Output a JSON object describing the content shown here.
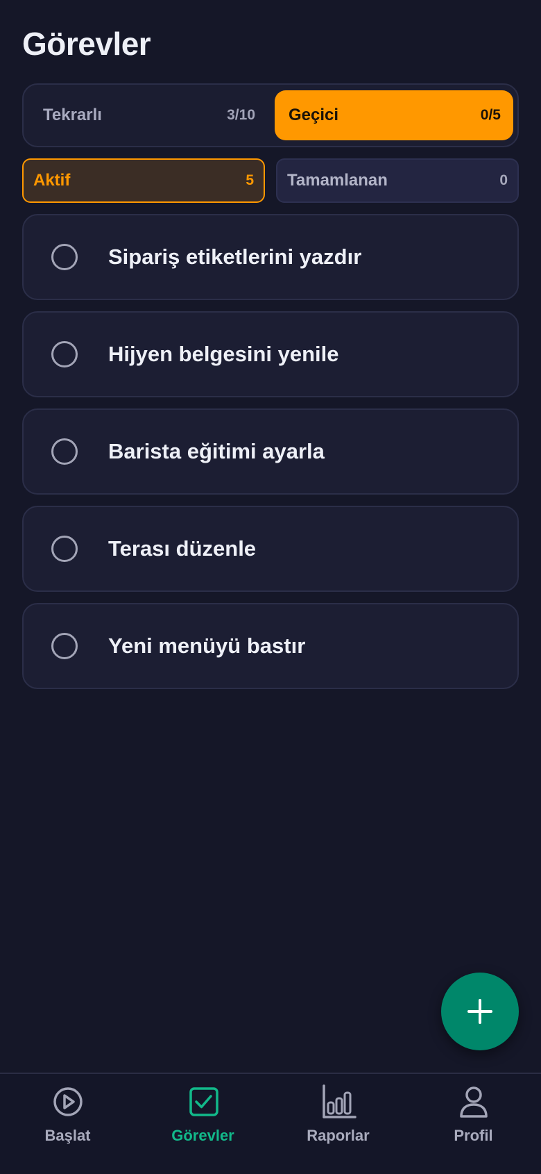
{
  "page": {
    "title": "Görevler"
  },
  "segments": [
    {
      "label": "Tekrarlı",
      "count": "3/10",
      "selected": false
    },
    {
      "label": "Geçici",
      "count": "0/5",
      "selected": true
    }
  ],
  "filters": [
    {
      "label": "Aktif",
      "count": "5",
      "selected": true
    },
    {
      "label": "Tamamlanan",
      "count": "0",
      "selected": false
    }
  ],
  "tasks": [
    {
      "label": "Sipariş etiketlerini yazdır",
      "done": false
    },
    {
      "label": "Hijyen belgesini yenile",
      "done": false
    },
    {
      "label": "Barista eğitimi ayarla",
      "done": false
    },
    {
      "label": "Terası düzenle",
      "done": false
    },
    {
      "label": "Yeni menüyü bastır",
      "done": false
    }
  ],
  "fab": {
    "icon": "plus-icon"
  },
  "nav": [
    {
      "label": "Başlat",
      "icon": "play-circle-icon",
      "active": false
    },
    {
      "label": "Görevler",
      "icon": "checkbox-icon",
      "active": true
    },
    {
      "label": "Raporlar",
      "icon": "bar-chart-icon",
      "active": false
    },
    {
      "label": "Profil",
      "icon": "user-icon",
      "active": false
    }
  ],
  "colors": {
    "background": "#151728",
    "accent": "#ff9800",
    "active_nav": "#12b98a",
    "fab": "#00876a"
  }
}
